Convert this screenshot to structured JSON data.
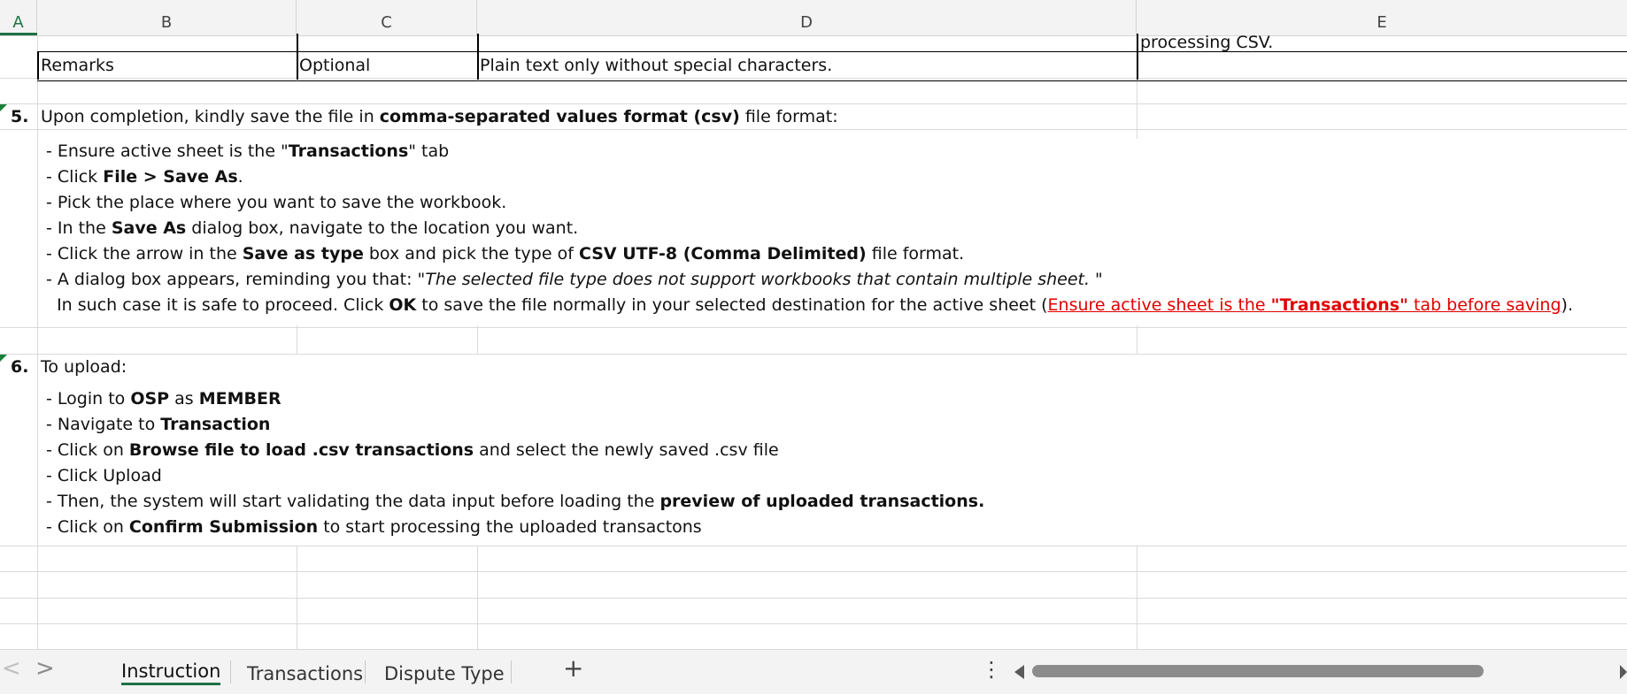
{
  "columns": [
    "A",
    "B",
    "C",
    "D",
    "E"
  ],
  "row_top_fragment": "processing CSV.",
  "remarks_row": {
    "field": "Remarks",
    "required": "Optional",
    "rule": "Plain text only without special characters."
  },
  "step5": {
    "number": "5.",
    "heading_pre": "Upon completion, kindly save the file in ",
    "heading_bold": "comma-separated values format (csv)",
    "heading_post": " file format:",
    "line1_pre": "- Ensure active sheet is the \"",
    "line1_bold": "Transactions",
    "line1_post": "\" tab",
    "line2_pre": "- Click ",
    "line2_bold": "File > Save As",
    "line2_post": ".",
    "line3": "- Pick the place where you want to save the workbook.",
    "line4_pre": "- In the ",
    "line4_bold": "Save As",
    "line4_post": " dialog box, navigate to the location you want.",
    "line5_pre": "- Click the arrow in the ",
    "line5_bold1": "Save as type",
    "line5_mid": " box and pick the type of ",
    "line5_bold2": "CSV UTF-8 (Comma Delimited)",
    "line5_post": " file format.",
    "line6_pre": "- A dialog box appears, reminding you that: \"",
    "line6_italic": "The selected file type does not support workbooks that contain multiple sheet.",
    "line6_post": " \"",
    "line7_pre": "  In such case it is safe to proceed. Click ",
    "line7_bold": "OK",
    "line7_mid": " to save the file normally in your selected destination for the active sheet (",
    "line7_red_pre": "Ensure active sheet is the ",
    "line7_red_bold": "\"Transactions\"",
    "line7_red_post": " tab before saving",
    "line7_post": ")."
  },
  "step6": {
    "number": "6.",
    "heading": "To upload:",
    "line1_pre": "- Login to ",
    "line1_bold1": "OSP",
    "line1_mid": " as ",
    "line1_bold2": "MEMBER",
    "line2_pre": "- Navigate to ",
    "line2_bold": "Transaction",
    "line3_pre": "- Click on ",
    "line3_bold": "Browse file to load .csv transactions",
    "line3_post": " and select the newly saved .csv file",
    "line4": "- Click Upload",
    "line5_pre": "- Then, the system will start validating the data input before loading the ",
    "line5_bold": "preview of uploaded transactions.",
    "line6_pre": "- Click on ",
    "line6_bold": "Confirm Submission",
    "line6_post": " to start processing the uploaded transactons"
  },
  "sheet_tabs": [
    {
      "label": "Instruction",
      "active": true
    },
    {
      "label": "Transactions",
      "active": false
    },
    {
      "label": "Dispute Type",
      "active": false
    }
  ],
  "add_sheet": "+",
  "more_menu": "⋮",
  "nav_prev": "<",
  "nav_next": ">"
}
